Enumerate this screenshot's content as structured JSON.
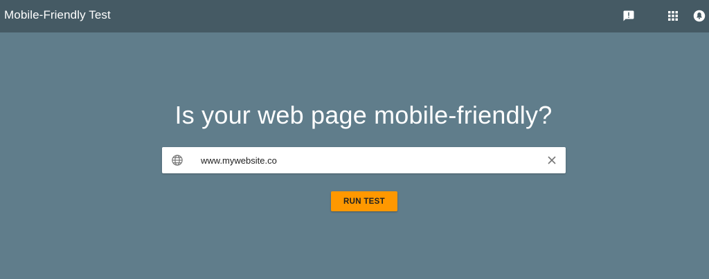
{
  "header": {
    "title": "Mobile-Friendly Test",
    "icons": [
      "feedback-icon",
      "apps-grid-icon",
      "account-icon"
    ],
    "background": "#455a64"
  },
  "main": {
    "headline": "Is your web page mobile-friendly?",
    "background": "#607d8b",
    "url_field": {
      "value": "www.mywebsite.co",
      "icon": "globe-icon",
      "clear_icon": "close-icon"
    },
    "run_button": {
      "label": "RUN TEST",
      "color": "#ff9800"
    }
  }
}
